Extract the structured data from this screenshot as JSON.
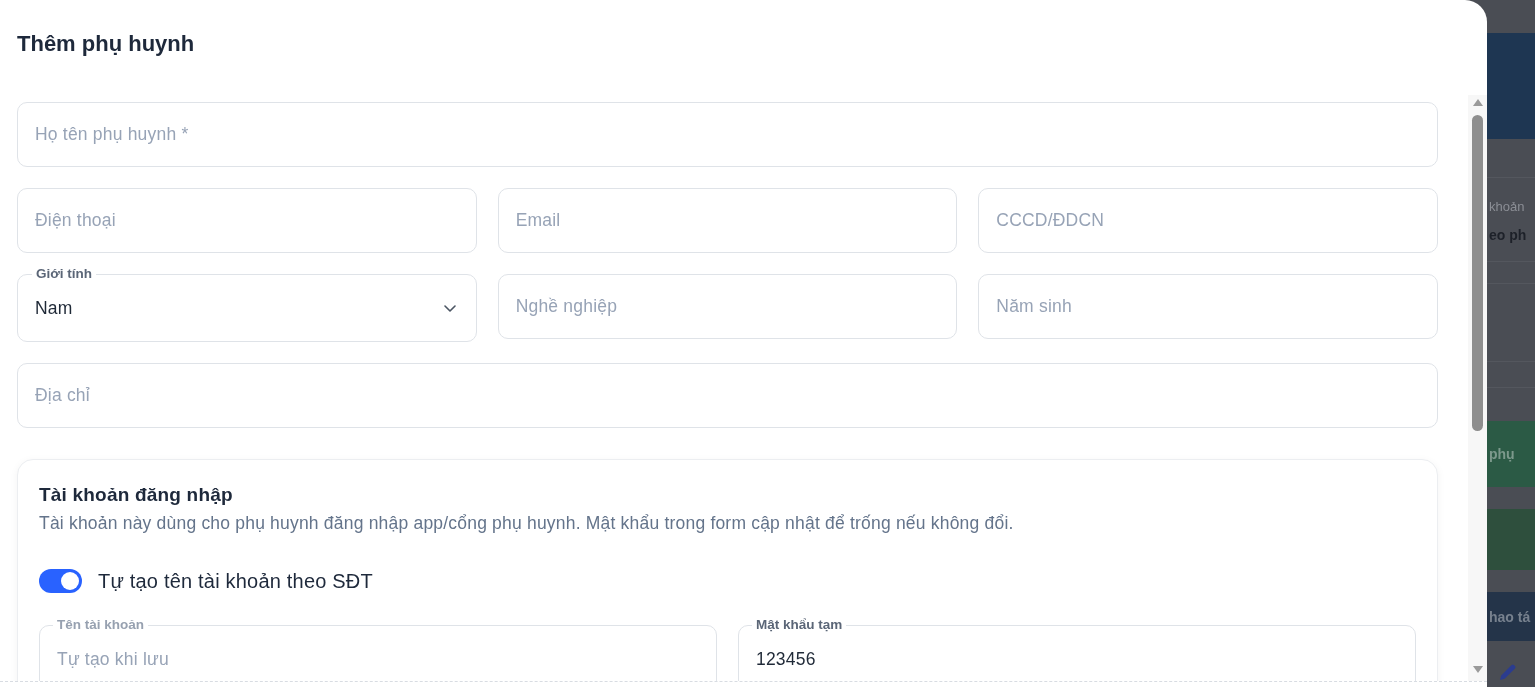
{
  "dialog": {
    "title": "Thêm phụ huynh"
  },
  "form": {
    "rows": [
      {
        "fields": [
          {
            "kind": "text",
            "placeholder": "Họ tên phụ huynh *"
          }
        ]
      },
      {
        "fields": [
          {
            "kind": "text",
            "placeholder": "Điện thoại"
          },
          {
            "kind": "text",
            "placeholder": "Email"
          },
          {
            "kind": "text",
            "placeholder": "CCCD/ĐDCN"
          }
        ]
      },
      {
        "fields": [
          {
            "kind": "select",
            "label": "Giới tính",
            "value": "Nam"
          },
          {
            "kind": "text",
            "placeholder": "Nghề nghiệp"
          },
          {
            "kind": "text",
            "placeholder": "Năm sinh"
          }
        ]
      },
      {
        "fields": [
          {
            "kind": "text",
            "placeholder": "Địa chỉ"
          }
        ]
      }
    ]
  },
  "account_section": {
    "title": "Tài khoản đăng nhập",
    "description": "Tài khoản này dùng cho phụ huynh đăng nhập app/cổng phụ huynh. Mật khẩu trong form cập nhật để trống nếu không đổi.",
    "toggle": {
      "label": "Tự tạo tên tài khoản theo SĐT",
      "on": true
    },
    "fields": [
      {
        "kind": "text",
        "label": "Tên tài khoản",
        "placeholder": "Tự tạo khi lưu"
      },
      {
        "kind": "text",
        "label": "Mật khẩu tạm",
        "value": "123456"
      }
    ]
  },
  "background_page": {
    "items": [
      {
        "kind": "caption",
        "text": "khoản"
      },
      {
        "kind": "heading",
        "text": "eo ph"
      },
      {
        "kind": "button",
        "text": "phụ",
        "color": "#2b5a45"
      },
      {
        "kind": "button",
        "text": "hao tá",
        "color": "#243449"
      }
    ]
  }
}
